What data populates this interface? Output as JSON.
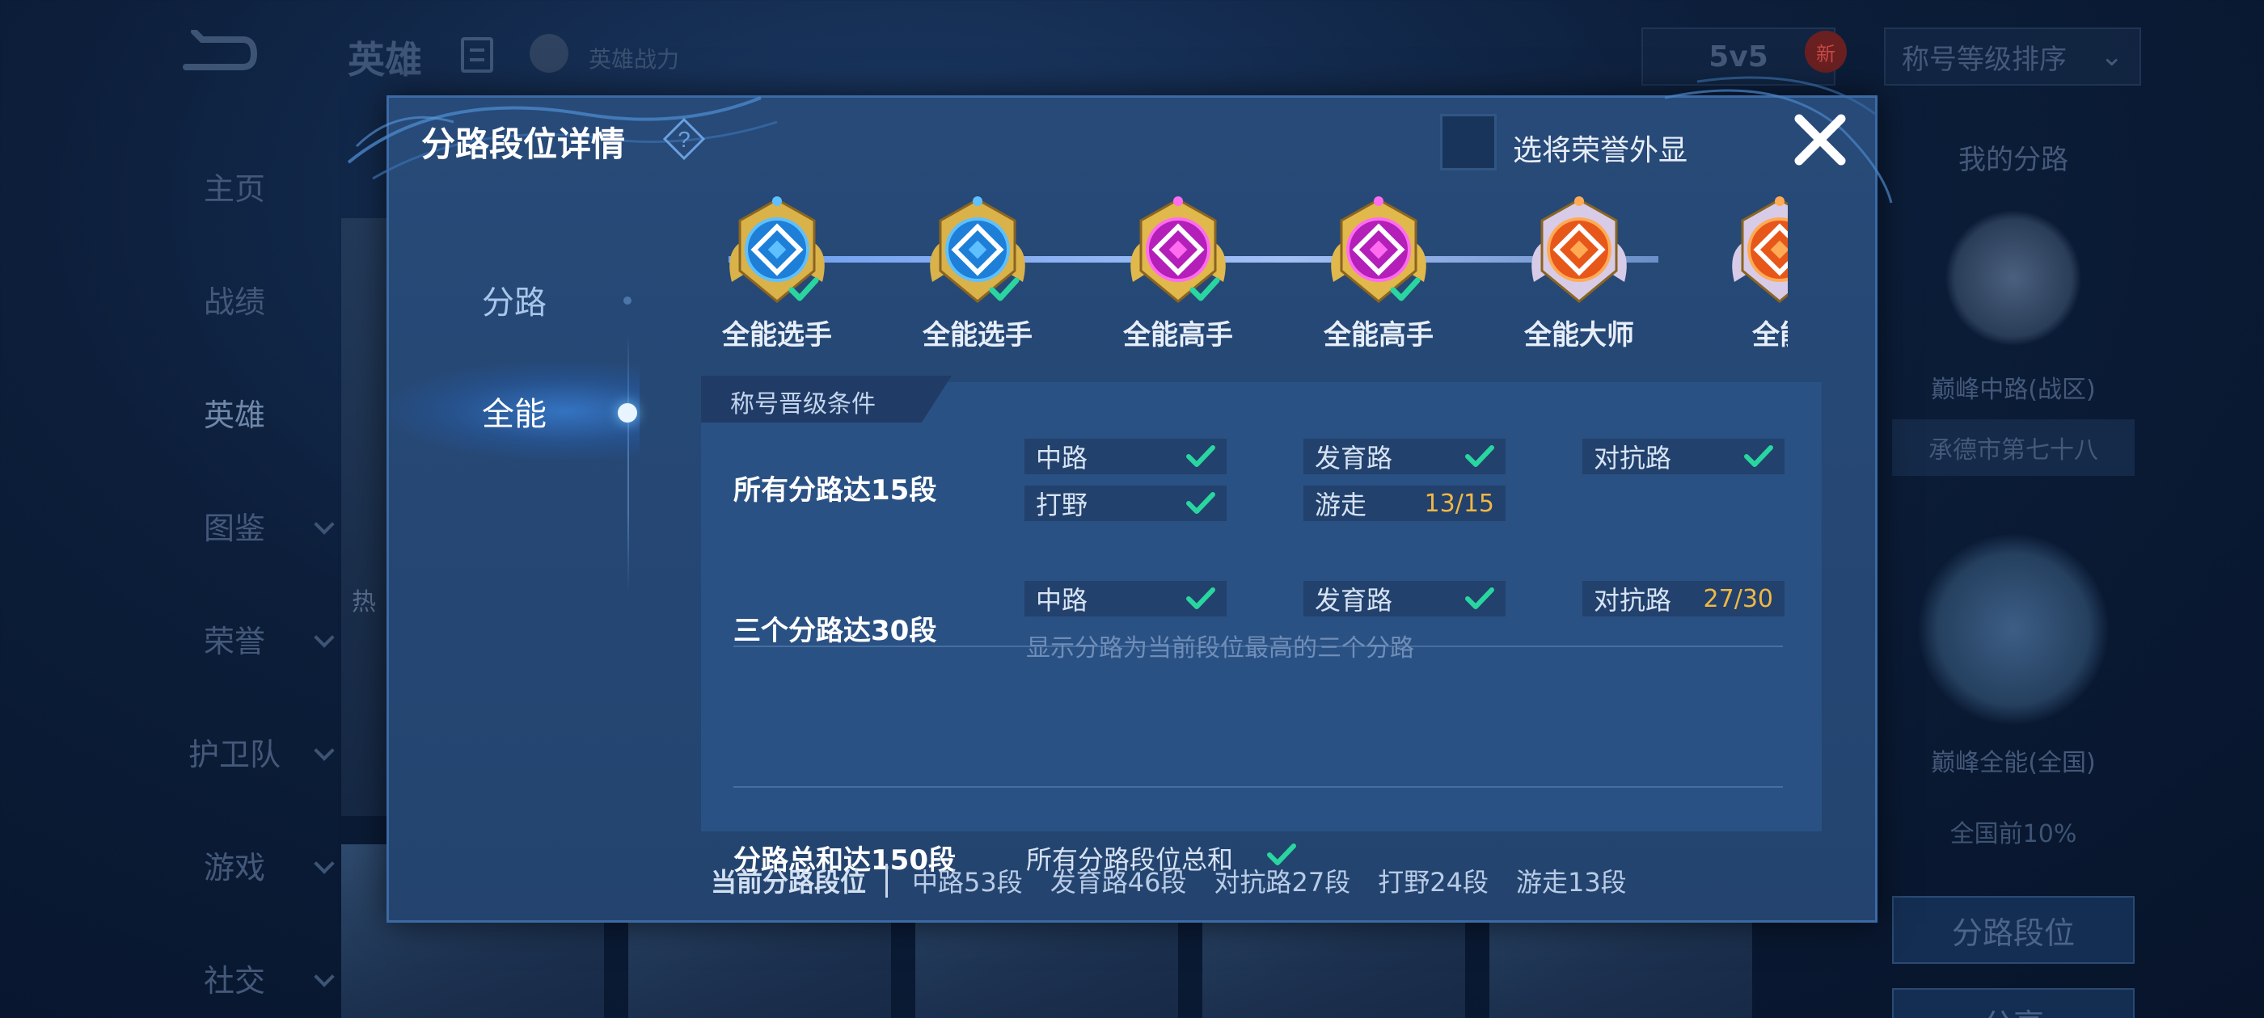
{
  "background": {
    "header": {
      "title": "英雄",
      "power_label": "英雄战力",
      "mode": "5v5",
      "new_badge": "新",
      "sort_label": "称号等级排序"
    },
    "nav": [
      {
        "label": "主页",
        "has_chevron": false
      },
      {
        "label": "战绩",
        "has_chevron": false
      },
      {
        "label": "英雄",
        "has_chevron": false,
        "active": true
      },
      {
        "label": "图鉴",
        "has_chevron": true
      },
      {
        "label": "荣誉",
        "has_chevron": true
      },
      {
        "label": "护卫队",
        "has_chevron": true
      },
      {
        "label": "游戏",
        "has_chevron": true
      },
      {
        "label": "社交",
        "has_chevron": true
      }
    ],
    "hero_card_label": "热",
    "right_panel": {
      "title": "我的分路",
      "rank1": "巅峰中路(战区)",
      "region": "承德市第七十八",
      "rank2": "巅峰全能(全国)",
      "percent": "全国前10%",
      "button1": "分路段位",
      "button2": "分享"
    }
  },
  "modal": {
    "title": "分路段位详情",
    "honor_display_label": "选将荣誉外显",
    "honor_display_checked": false,
    "side_tabs": [
      {
        "label": "分路",
        "active": false
      },
      {
        "label": "全能",
        "active": true
      }
    ],
    "badges": [
      {
        "label": "全能选手",
        "tier": "blue",
        "achieved": true
      },
      {
        "label": "全能选手",
        "tier": "blue",
        "achieved": true
      },
      {
        "label": "全能高手",
        "tier": "purple",
        "achieved": true
      },
      {
        "label": "全能高手",
        "tier": "purple",
        "achieved": true
      },
      {
        "label": "全能大师",
        "tier": "orange",
        "achieved": false
      },
      {
        "label": "全能",
        "tier": "orange",
        "achieved": false
      }
    ],
    "conditions": {
      "tab_label": "称号晋级条件",
      "rows": [
        {
          "name": "所有分路达15段",
          "items": [
            {
              "label": "中路",
              "done": true
            },
            {
              "label": "发育路",
              "done": true
            },
            {
              "label": "对抗路",
              "done": true
            },
            {
              "label": "打野",
              "done": true
            },
            {
              "label": "游走",
              "progress": "13/15",
              "done": false
            }
          ]
        },
        {
          "name": "三个分路达30段",
          "items": [
            {
              "label": "中路",
              "done": true
            },
            {
              "label": "发育路",
              "done": true
            },
            {
              "label": "对抗路",
              "progress": "27/30",
              "done": false
            }
          ],
          "note": "显示分路为当前段位最高的三个分路"
        },
        {
          "name": "分路总和达150段",
          "text": "所有分路段位总和",
          "done": true
        }
      ]
    },
    "footer": {
      "title": "当前分路段位",
      "items": [
        "中路53段",
        "发育路46段",
        "对抗路27段",
        "打野24段",
        "游走13段"
      ]
    }
  },
  "colors": {
    "progress": "#f0b744",
    "check": "#29d6a0",
    "modal_bg": "#274a78"
  }
}
